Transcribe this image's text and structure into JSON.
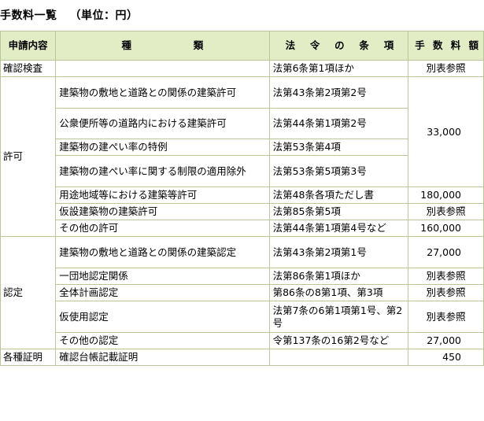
{
  "title": "手数料一覧",
  "unit": "（単位：円）",
  "header": {
    "application": "申請内容",
    "kind_chars": [
      "種",
      "類"
    ],
    "law_chars": [
      "法",
      "令",
      "の",
      "条",
      "項"
    ],
    "fee_chars": [
      "手",
      "数",
      "料",
      "額"
    ]
  },
  "rows": {
    "r1": {
      "app": "確認検査",
      "kind": "",
      "law": "法第6条第1項ほか",
      "fee": "別表参照"
    },
    "permit_label": "許可",
    "r2": {
      "kind": "建築物の敷地と道路との関係の建築許可",
      "law": "法第43条第2項第2号"
    },
    "r3": {
      "kind": "公衆便所等の道路内における建築許可",
      "law": "法第44条第1項第2号"
    },
    "r4": {
      "kind": "建築物の建ぺい率の特例",
      "law": "法第53条第4項"
    },
    "r5": {
      "kind": "建築物の建ぺい率に関する制限の適用除外",
      "law": "法第53条第5項第3号"
    },
    "permit_shared_fee": "33,000",
    "r6": {
      "kind": "用途地域等における建築等許可",
      "law": "法第48条各項ただし書",
      "fee": "180,000"
    },
    "r7": {
      "kind": "仮設建築物の建築許可",
      "law": "法第85条第5項",
      "fee": "別表参照"
    },
    "r8": {
      "kind": "その他の許可",
      "law": "法第44条第1項第4号など",
      "fee": "160,000"
    },
    "cert_label": "認定",
    "r9": {
      "kind": "建築物の敷地と道路との関係の建築認定",
      "law": "法第43条第2項第1号",
      "fee": "27,000"
    },
    "r10": {
      "kind": "一団地認定関係",
      "law": "法第86条第1項ほか",
      "fee": "別表参照"
    },
    "r11": {
      "kind": "全体計画認定",
      "law": "第86条の8第1項、第3項",
      "fee": "別表参照"
    },
    "r12": {
      "kind": "仮使用認定",
      "law": "法第7条の6第1項第1号、第2号",
      "fee": "別表参照"
    },
    "r13": {
      "kind": "その他の認定",
      "law": "令第137条の16第2号など",
      "fee": "27,000"
    },
    "r14": {
      "app": "各種証明",
      "kind": "確認台帳記載証明",
      "law": "",
      "fee": "450"
    }
  },
  "colors": {
    "header_bg": "#e2edc6",
    "border": "#b8c69a"
  }
}
